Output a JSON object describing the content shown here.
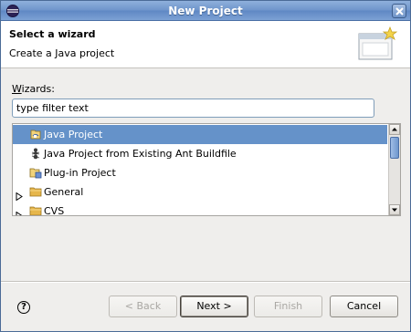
{
  "window": {
    "title": "New Project",
    "icon": "eclipse-icon"
  },
  "header": {
    "title": "Select a wizard",
    "description": "Create a Java project",
    "banner_icon": "new-wizard-banner-icon"
  },
  "filter": {
    "label_prefix": "W",
    "label_rest": "izards:",
    "value": "type filter text"
  },
  "tree": {
    "items": [
      {
        "label": "Java Project",
        "icon": "java-project-icon",
        "selected": true,
        "expandable": false
      },
      {
        "label": "Java Project from Existing Ant Buildfile",
        "icon": "ant-icon",
        "selected": false,
        "expandable": false
      },
      {
        "label": "Plug-in Project",
        "icon": "plugin-project-icon",
        "selected": false,
        "expandable": false
      },
      {
        "label": "General",
        "icon": "folder-icon",
        "selected": false,
        "expandable": true
      },
      {
        "label": "CVS",
        "icon": "folder-icon",
        "selected": false,
        "expandable": true
      }
    ]
  },
  "buttons": {
    "help": "?",
    "back": "< Back",
    "next": "Next >",
    "finish": "Finish",
    "cancel": "Cancel"
  },
  "colors": {
    "selection": "#6592c9",
    "titlebar": "#6f95cb"
  }
}
